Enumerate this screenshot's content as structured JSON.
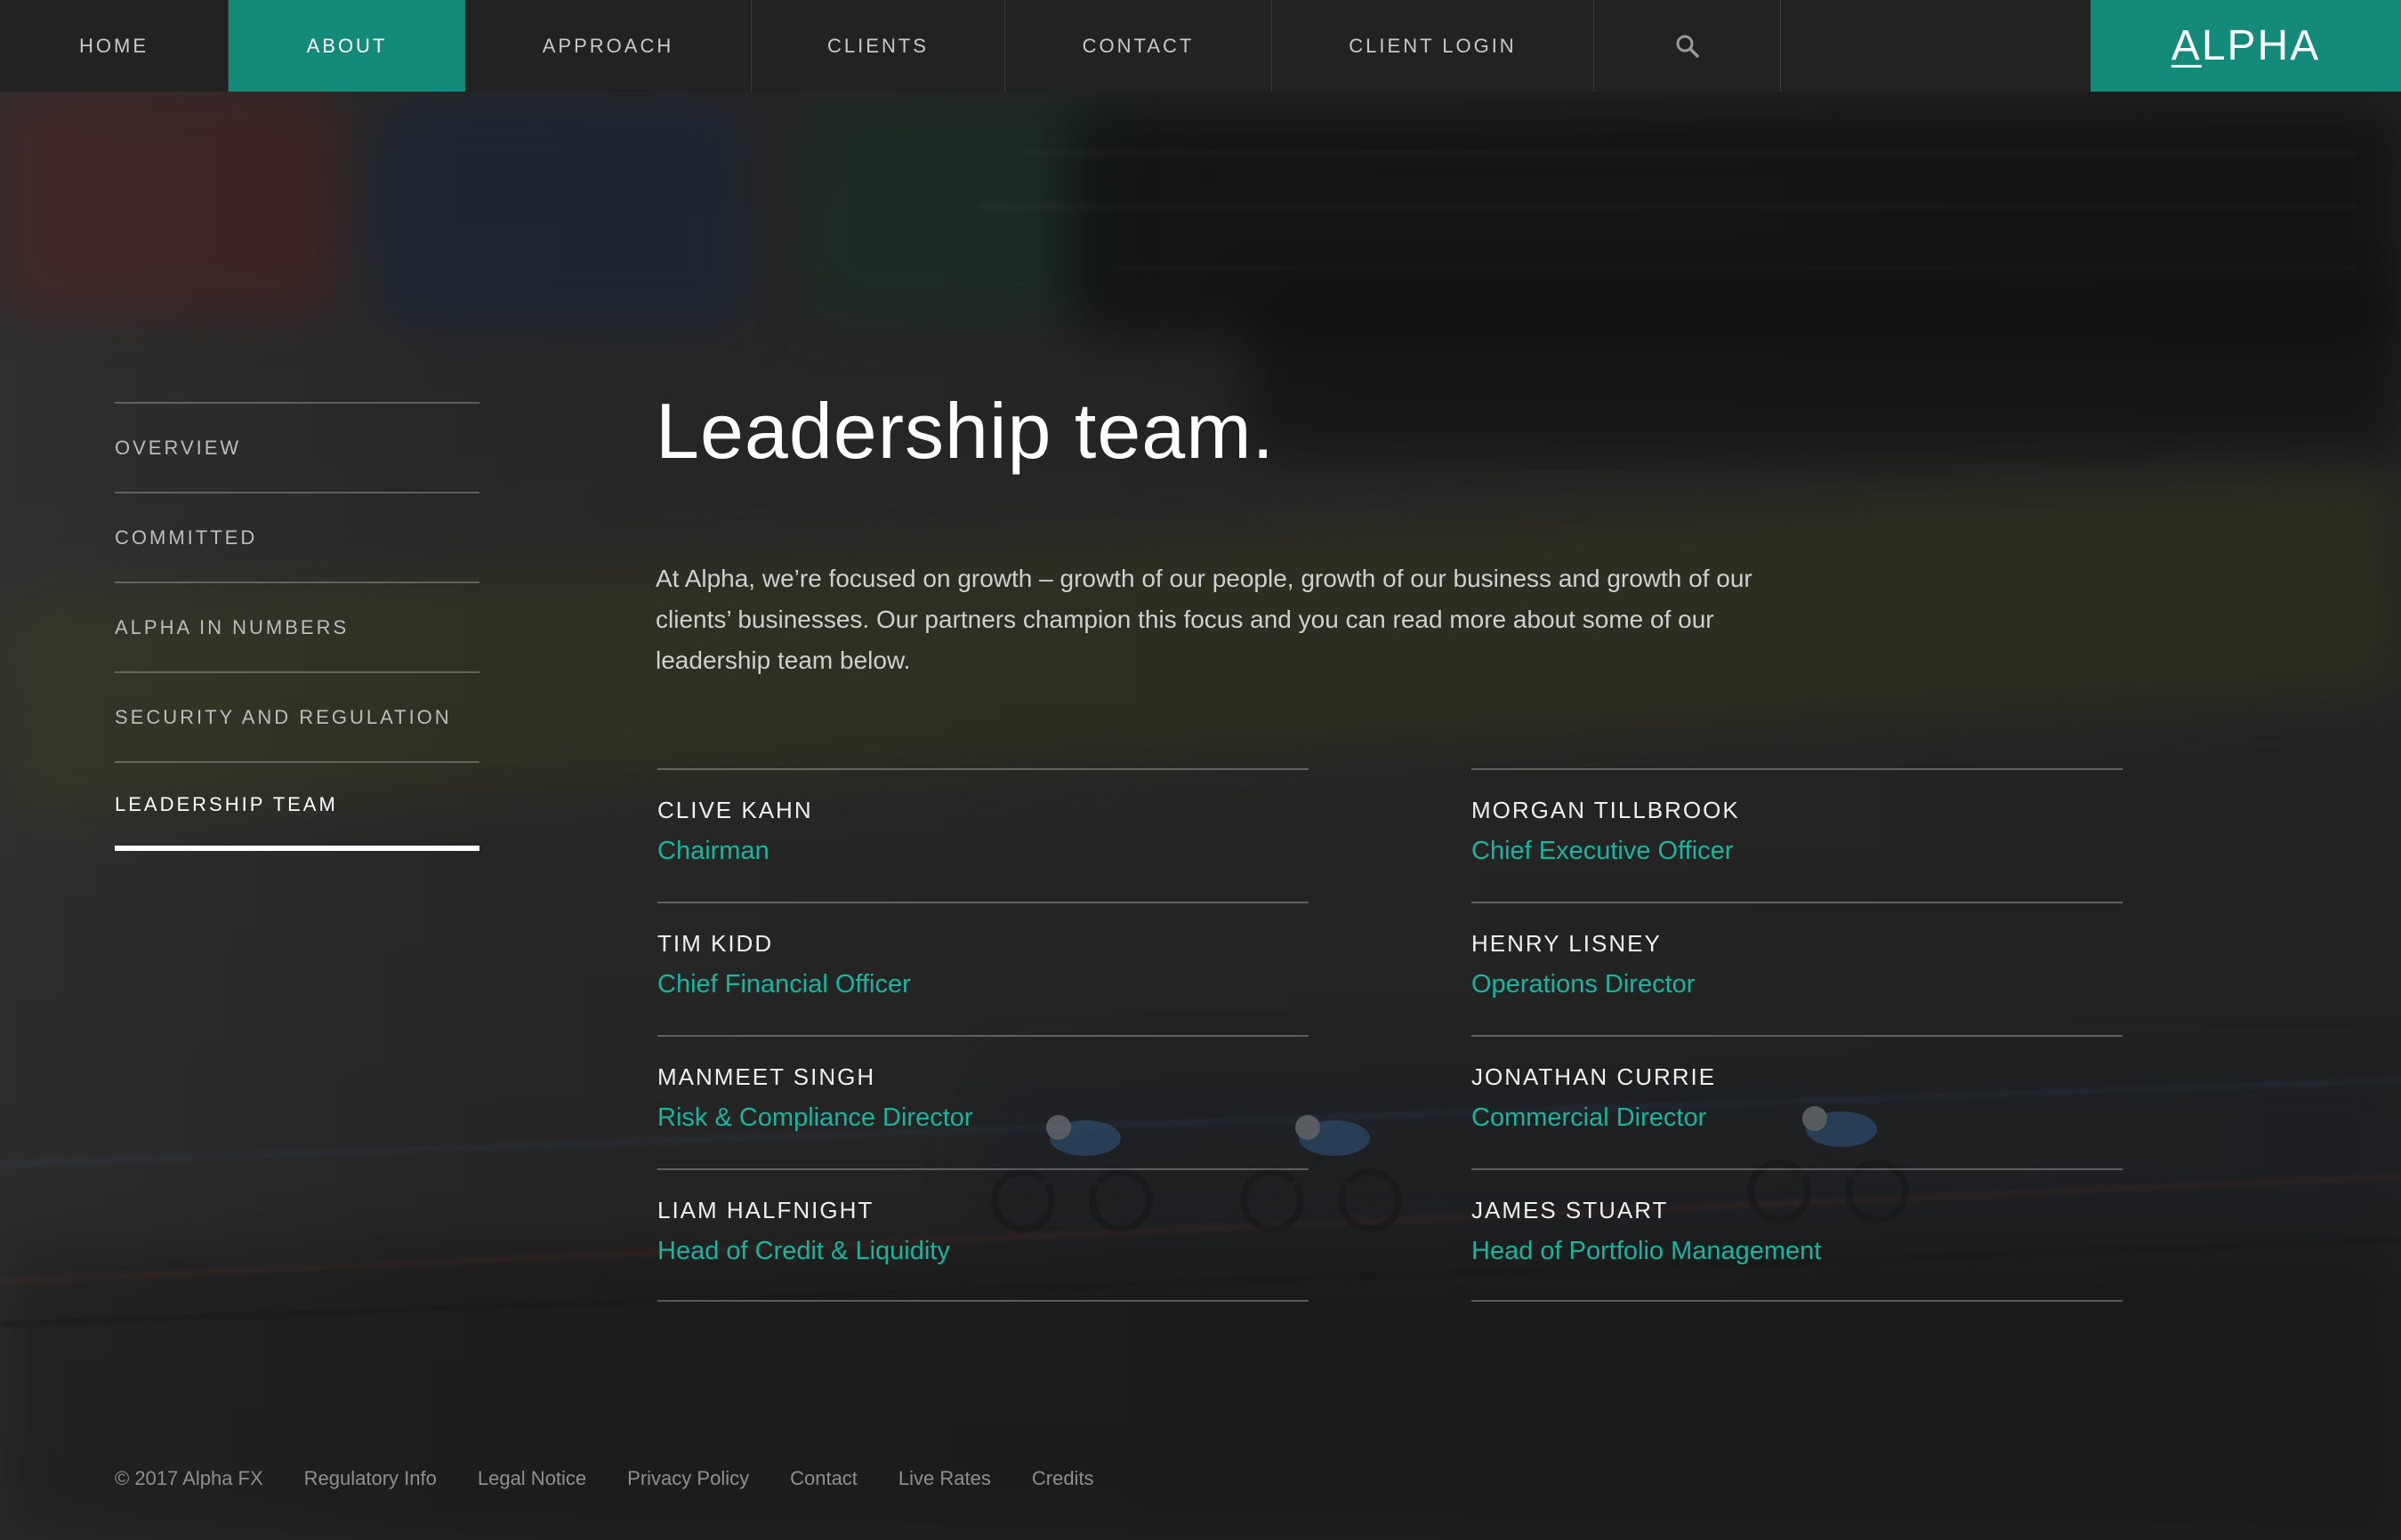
{
  "nav": {
    "home": "HOME",
    "about": "ABOUT",
    "approach": "APPROACH",
    "clients": "CLIENTS",
    "contact": "CONTACT",
    "client_login": "CLIENT LOGIN",
    "search_icon": "search-icon",
    "active": "ABOUT"
  },
  "logo": {
    "first_letter": "A",
    "rest": "LPHA"
  },
  "sidebar": {
    "items": [
      {
        "label": "OVERVIEW"
      },
      {
        "label": "COMMITTED"
      },
      {
        "label": "ALPHA IN NUMBERS"
      },
      {
        "label": "SECURITY AND REGULATION"
      },
      {
        "label": "LEADERSHIP TEAM"
      }
    ],
    "active": "LEADERSHIP TEAM"
  },
  "main": {
    "title": "Leadership team.",
    "intro": "At Alpha, we’re focused on growth – growth of our people, growth of our business and growth of our clients’ businesses. Our partners champion this focus and you can read more about some of our leadership team below."
  },
  "team": {
    "left": [
      {
        "name": "CLIVE KAHN",
        "title": "Chairman"
      },
      {
        "name": "TIM KIDD",
        "title": "Chief Financial Officer"
      },
      {
        "name": "MANMEET SINGH",
        "title": "Risk & Compliance Director"
      },
      {
        "name": "LIAM HALFNIGHT",
        "title": "Head of Credit & Liquidity"
      }
    ],
    "right": [
      {
        "name": "MORGAN TILLBROOK",
        "title": "Chief Executive Officer"
      },
      {
        "name": "HENRY LISNEY",
        "title": "Operations Director"
      },
      {
        "name": "JONATHAN CURRIE",
        "title": "Commercial Director"
      },
      {
        "name": "JAMES STUART",
        "title": "Head of Portfolio Management"
      }
    ]
  },
  "footer": {
    "copyright": "© 2017 Alpha FX",
    "links": [
      "Regulatory Info",
      "Legal Notice",
      "Privacy Policy",
      "Contact",
      "Live Rates",
      "Credits"
    ]
  },
  "colors": {
    "accent": "#138a7a",
    "role_text": "#19b5a0",
    "nav_bg": "#222222"
  }
}
